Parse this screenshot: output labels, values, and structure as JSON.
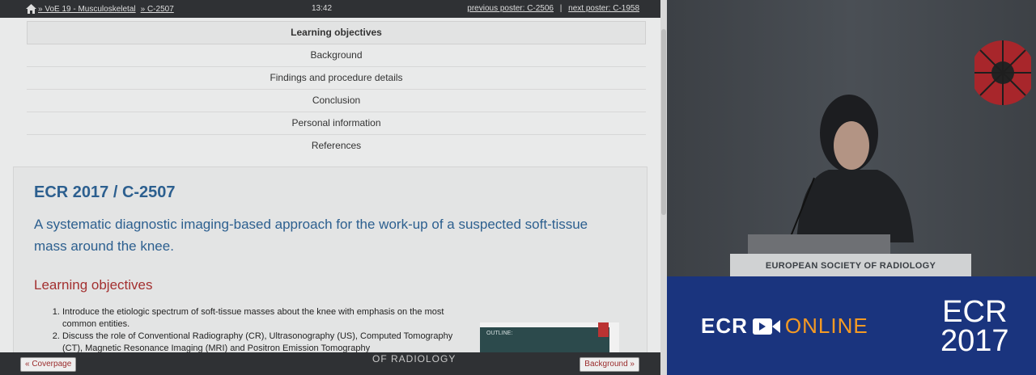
{
  "topbar": {
    "breadcrumb": "» VoE 19 - Musculoskeletal",
    "poster_id": "» C-2507",
    "time": "13:42",
    "prev": "previous poster: C-2506",
    "separator": "|",
    "next": "next poster: C-1958"
  },
  "menu": {
    "items": [
      "Learning objectives",
      "Background",
      "Findings and procedure details",
      "Conclusion",
      "Personal information",
      "References"
    ]
  },
  "card": {
    "code": "ECR 2017 / C-2507",
    "title": "A systematic diagnostic imaging-based approach for the work-up of a suspected soft-tissue mass around the knee.",
    "section": "Learning objectives",
    "list": [
      "Introduce the etiologic spectrum of soft-tissue masses about the knee with emphasis on the most common entities.",
      "Discuss the role of Conventional Radiography (CR), Ultrasonography (US), Computed Tomography (CT), Magnetic Resonance Imaging (MRI) and Positron Emission Tomography"
    ],
    "thumb_text": "OUTLINE:"
  },
  "bottombar": {
    "prev_label": "« Coverpage",
    "next_label": "Background »",
    "watermark": "OF RADIOLOGY"
  },
  "video": {
    "podium": "EUROPEAN SOCIETY OF RADIOLOGY",
    "brand_ecr": "ECR",
    "brand_online": "ONLINE",
    "year_top": "ECR",
    "year_bottom": "2017"
  }
}
